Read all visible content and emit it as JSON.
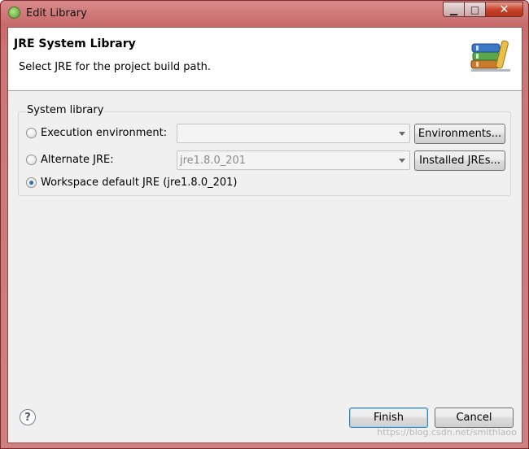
{
  "window": {
    "title": "Edit Library",
    "minimize_glyph": "▁",
    "maximize_glyph": "□",
    "close_glyph": "✕"
  },
  "header": {
    "title": "JRE System Library",
    "description": "Select JRE for the project build path.",
    "icon": "library-books-icon"
  },
  "system_library": {
    "group_label": "System library",
    "execution_environment": {
      "label": "Execution environment:",
      "selected": false,
      "combo_value": "",
      "button": "Environments..."
    },
    "alternate_jre": {
      "label": "Alternate JRE:",
      "selected": false,
      "combo_value": "jre1.8.0_201",
      "button": "Installed JREs..."
    },
    "workspace_default": {
      "label": "Workspace default JRE (jre1.8.0_201)",
      "selected": true
    }
  },
  "footer": {
    "help_glyph": "?",
    "finish": "Finish",
    "cancel": "Cancel"
  },
  "watermark": "https://blog.csdn.net/smithlaoo"
}
